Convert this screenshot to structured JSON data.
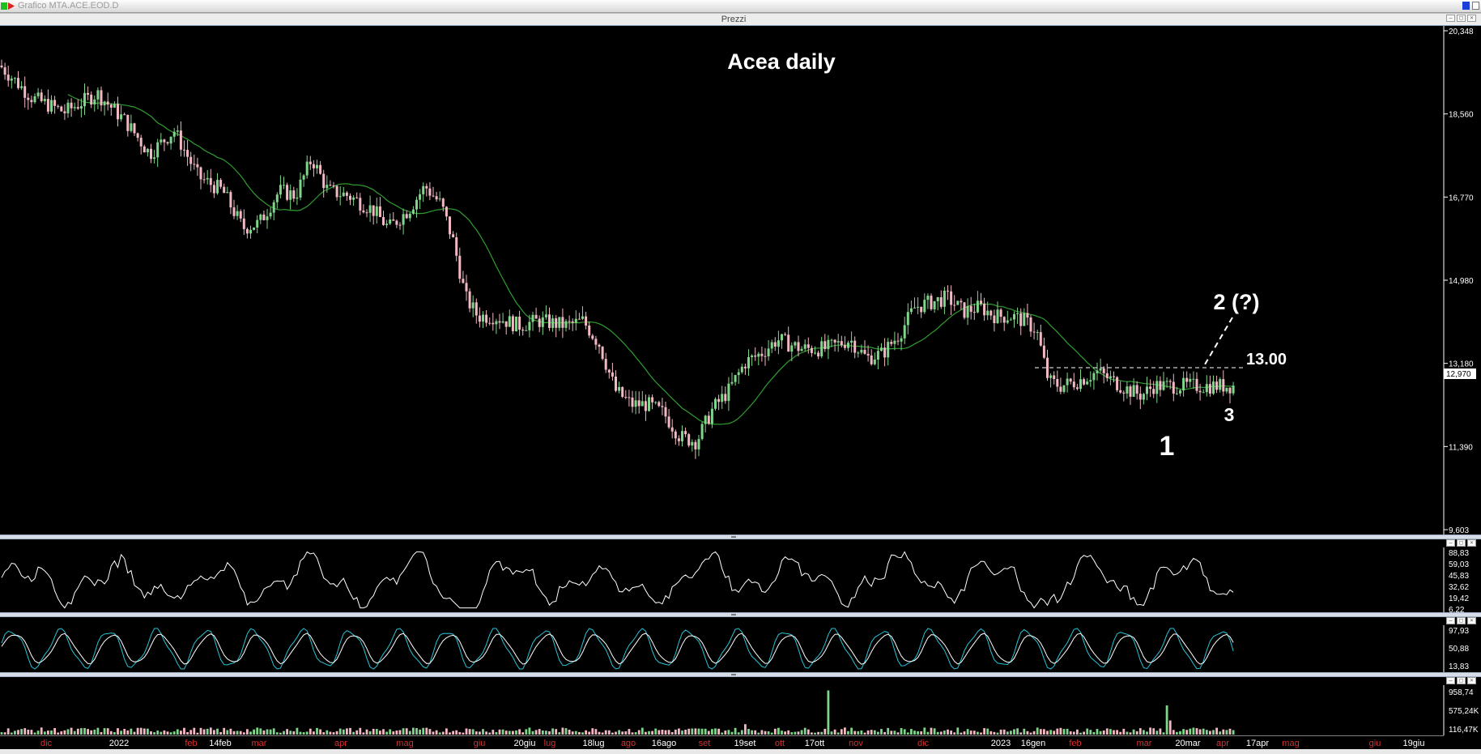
{
  "window": {
    "title": "Grafico MTA.ACE.EOD.D",
    "panel_title": "Prezzi"
  },
  "colors": {
    "background": "#000000",
    "candle_up": "#7fd68a",
    "candle_down": "#f2b8c4",
    "moving_average": "#2f9e2f",
    "oscillator_line": "#ffffff",
    "stoch_k": "#29c3d8",
    "axis_text": "#ffffff",
    "month_label": "#d83030",
    "date_label": "#ffffff"
  },
  "annotations": {
    "title": "Acea daily",
    "wave1": "1",
    "wave2": "2 (?)",
    "wave3": "3",
    "level": "13.00"
  },
  "price_axis": {
    "ticks": [
      "20,348",
      "18,560",
      "16,770",
      "14,980",
      "13,180",
      "11,390",
      "9,603"
    ],
    "last_price": "12,970"
  },
  "rsi_axis": {
    "ticks": [
      "88,83",
      "59,03",
      "45,83",
      "32,62",
      "19,42",
      "6,22"
    ]
  },
  "stoch_axis": {
    "ticks": [
      "97,93",
      "50,88",
      "13,83"
    ]
  },
  "volume_axis": {
    "ticks": [
      "958,74",
      "575,24K",
      "116,47K"
    ]
  },
  "time_axis": [
    {
      "label": "dic",
      "type": "month"
    },
    {
      "label": "2022",
      "type": "date"
    },
    {
      "label": "feb",
      "type": "month"
    },
    {
      "label": "14feb",
      "type": "date"
    },
    {
      "label": "mar",
      "type": "month"
    },
    {
      "label": "apr",
      "type": "month"
    },
    {
      "label": "mag",
      "type": "month"
    },
    {
      "label": "giu",
      "type": "month"
    },
    {
      "label": "20giu",
      "type": "date"
    },
    {
      "label": "lug",
      "type": "month"
    },
    {
      "label": "18lug",
      "type": "date"
    },
    {
      "label": "ago",
      "type": "month"
    },
    {
      "label": "16ago",
      "type": "date"
    },
    {
      "label": "set",
      "type": "month"
    },
    {
      "label": "19set",
      "type": "date"
    },
    {
      "label": "ott",
      "type": "month"
    },
    {
      "label": "17ott",
      "type": "date"
    },
    {
      "label": "nov",
      "type": "month"
    },
    {
      "label": "dic",
      "type": "month"
    },
    {
      "label": "2023",
      "type": "date"
    },
    {
      "label": "16gen",
      "type": "date"
    },
    {
      "label": "feb",
      "type": "month"
    },
    {
      "label": "mar",
      "type": "month"
    },
    {
      "label": "20mar",
      "type": "date"
    },
    {
      "label": "apr",
      "type": "month"
    },
    {
      "label": "17apr",
      "type": "date"
    },
    {
      "label": "mag",
      "type": "month"
    },
    {
      "label": "giu",
      "type": "month"
    },
    {
      "label": "19giu",
      "type": "date"
    }
  ],
  "chart_data": {
    "type": "line",
    "ylim": [
      9.603,
      20.348
    ],
    "series": [],
    "price_anchors": [
      [
        0,
        19.6
      ],
      [
        40,
        18.9
      ],
      [
        80,
        18.6
      ],
      [
        120,
        19.0
      ],
      [
        155,
        18.4
      ],
      [
        185,
        17.7
      ],
      [
        215,
        18.2
      ],
      [
        245,
        17.2
      ],
      [
        275,
        16.9
      ],
      [
        300,
        16.1
      ],
      [
        320,
        16.2
      ],
      [
        345,
        16.9
      ],
      [
        365,
        16.8
      ],
      [
        385,
        17.6
      ],
      [
        405,
        16.9
      ],
      [
        430,
        16.8
      ],
      [
        460,
        16.5
      ],
      [
        480,
        16.1
      ],
      [
        505,
        16.5
      ],
      [
        525,
        17.0
      ],
      [
        545,
        16.6
      ],
      [
        560,
        15.8
      ],
      [
        575,
        14.6
      ],
      [
        590,
        14.2
      ],
      [
        610,
        14.2
      ],
      [
        640,
        14.0
      ],
      [
        665,
        14.1
      ],
      [
        700,
        14.0
      ],
      [
        720,
        14.1
      ],
      [
        740,
        13.6
      ],
      [
        760,
        12.6
      ],
      [
        780,
        12.3
      ],
      [
        800,
        12.3
      ],
      [
        820,
        12.1
      ],
      [
        840,
        11.6
      ],
      [
        860,
        11.5
      ],
      [
        880,
        12.2
      ],
      [
        900,
        12.6
      ],
      [
        920,
        13.2
      ],
      [
        940,
        13.4
      ],
      [
        960,
        13.7
      ],
      [
        990,
        13.5
      ],
      [
        1020,
        13.5
      ],
      [
        1050,
        13.7
      ],
      [
        1070,
        13.3
      ],
      [
        1090,
        13.4
      ],
      [
        1110,
        13.8
      ],
      [
        1130,
        14.4
      ],
      [
        1150,
        14.5
      ],
      [
        1170,
        14.6
      ],
      [
        1190,
        14.3
      ],
      [
        1210,
        14.4
      ],
      [
        1230,
        14.2
      ],
      [
        1250,
        14.2
      ],
      [
        1265,
        14.1
      ],
      [
        1280,
        13.9
      ],
      [
        1295,
        12.8
      ],
      [
        1310,
        12.7
      ],
      [
        1330,
        12.8
      ],
      [
        1355,
        13.0
      ],
      [
        1375,
        12.8
      ],
      [
        1395,
        12.6
      ],
      [
        1410,
        12.5
      ],
      [
        1425,
        12.7
      ]
    ],
    "volume_spikes": [
      {
        "x": 1022,
        "value": 940000
      },
      {
        "x": 1440,
        "value": 620000
      },
      {
        "x": 920,
        "value": 220000
      },
      {
        "x": 1445,
        "value": 300000
      }
    ]
  }
}
